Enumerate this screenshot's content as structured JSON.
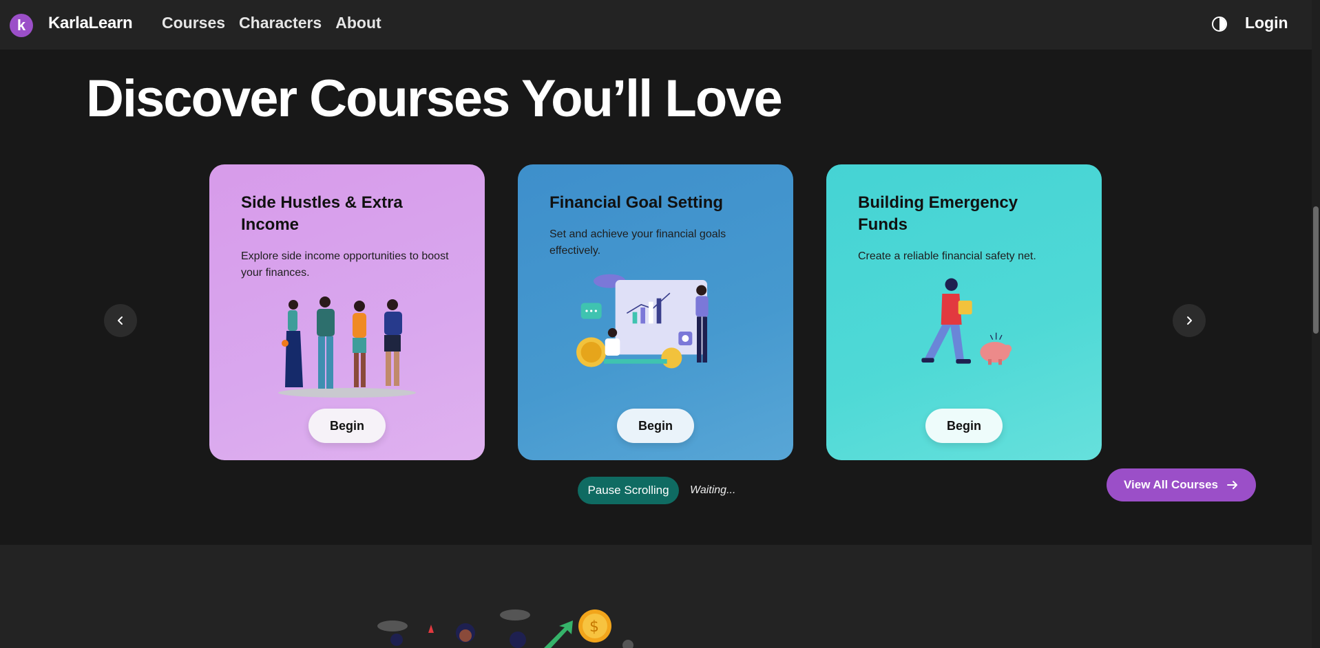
{
  "nav": {
    "logo_letter": "k",
    "brand": "KarlaLearn",
    "links": [
      "Courses",
      "Characters",
      "About"
    ],
    "login": "Login",
    "theme_icon": "half-circle-contrast-icon"
  },
  "hero": {
    "title": "Discover Courses You’ll Love"
  },
  "carousel": {
    "cards": [
      {
        "title": "Side Hustles & Extra Income",
        "description": "Explore side income opportunities to boost your finances.",
        "button": "Begin",
        "color": "#d9a3ec"
      },
      {
        "title": "Financial Goal Setting",
        "description": "Set and achieve your financial goals effectively.",
        "button": "Begin",
        "color": "#4496cd"
      },
      {
        "title": "Building Emergency Funds",
        "description": "Create a reliable financial safety net.",
        "button": "Begin",
        "color": "#4ed7d6"
      }
    ],
    "prev_icon": "chevron-left-icon",
    "next_icon": "chevron-right-icon",
    "pause_label": "Pause Scrolling",
    "status": "Waiting..."
  },
  "view_all": {
    "label": "View All Courses",
    "icon": "arrow-right-icon"
  },
  "colors": {
    "accent": "#9b4fc8",
    "pause": "#0f6b62",
    "background": "#181818",
    "navbar": "#232323"
  }
}
